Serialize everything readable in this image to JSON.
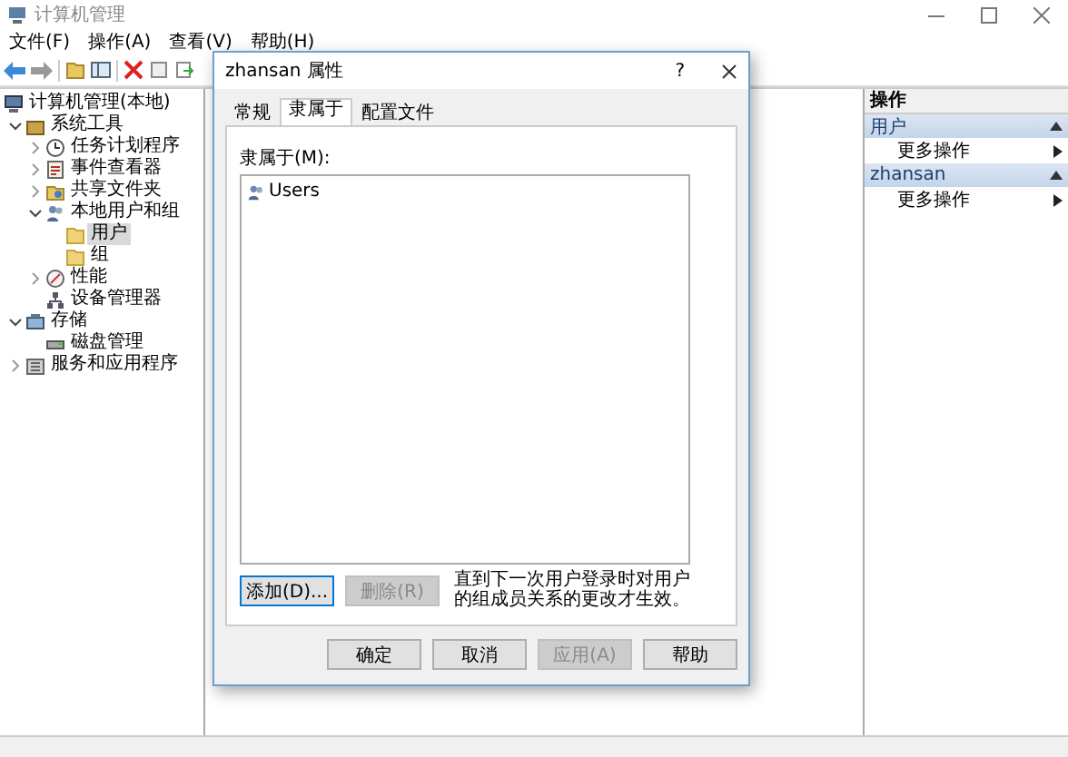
{
  "window": {
    "title": "计算机管理"
  },
  "menu": [
    "文件(F)",
    "操作(A)",
    "查看(V)",
    "帮助(H)"
  ],
  "tree": [
    {
      "label": "计算机管理(本地)",
      "selected": false,
      "children": [
        {
          "label": "系统工具",
          "expanded": true,
          "selected": false,
          "children": [
            {
              "label": "任务计划程序",
              "expanded": false,
              "selected": false
            },
            {
              "label": "事件查看器",
              "expanded": false,
              "selected": false
            },
            {
              "label": "共享文件夹",
              "expanded": false,
              "selected": false
            },
            {
              "label": "本地用户和组",
              "expanded": true,
              "selected": false,
              "children": [
                {
                  "label": "用户",
                  "selected": true
                },
                {
                  "label": "组",
                  "selected": false
                }
              ]
            },
            {
              "label": "性能",
              "expanded": false,
              "selected": false
            },
            {
              "label": "设备管理器",
              "selected": false
            }
          ]
        },
        {
          "label": "存储",
          "expanded": true,
          "selected": false,
          "children": [
            {
              "label": "磁盘管理",
              "selected": false
            }
          ]
        },
        {
          "label": "服务和应用程序",
          "expanded": false,
          "selected": false
        }
      ]
    }
  ],
  "actions": {
    "title": "操作",
    "sections": [
      {
        "title": "用户",
        "items": [
          "更多操作"
        ]
      },
      {
        "title": "zhansan",
        "items": [
          "更多操作"
        ]
      }
    ]
  },
  "dialog": {
    "title": "zhansan 属性",
    "help": "?",
    "tabs": [
      {
        "label": "常规",
        "selected": false
      },
      {
        "label": "隶属于",
        "selected": true
      },
      {
        "label": "配置文件",
        "selected": false
      }
    ],
    "members_label": "隶属于(M):",
    "members": [
      "Users"
    ],
    "buttons": [
      {
        "label": "添加(D)...",
        "disabled": false
      },
      {
        "label": "删除(R)",
        "disabled": true
      }
    ],
    "note": "直到下一次用户登录时对用户的组成员关系的更改才生效。",
    "footer_buttons": [
      {
        "label": "确定",
        "disabled": false
      },
      {
        "label": "取消",
        "disabled": false
      },
      {
        "label": "应用(A)",
        "disabled": true
      },
      {
        "label": "帮助",
        "disabled": false
      }
    ]
  }
}
